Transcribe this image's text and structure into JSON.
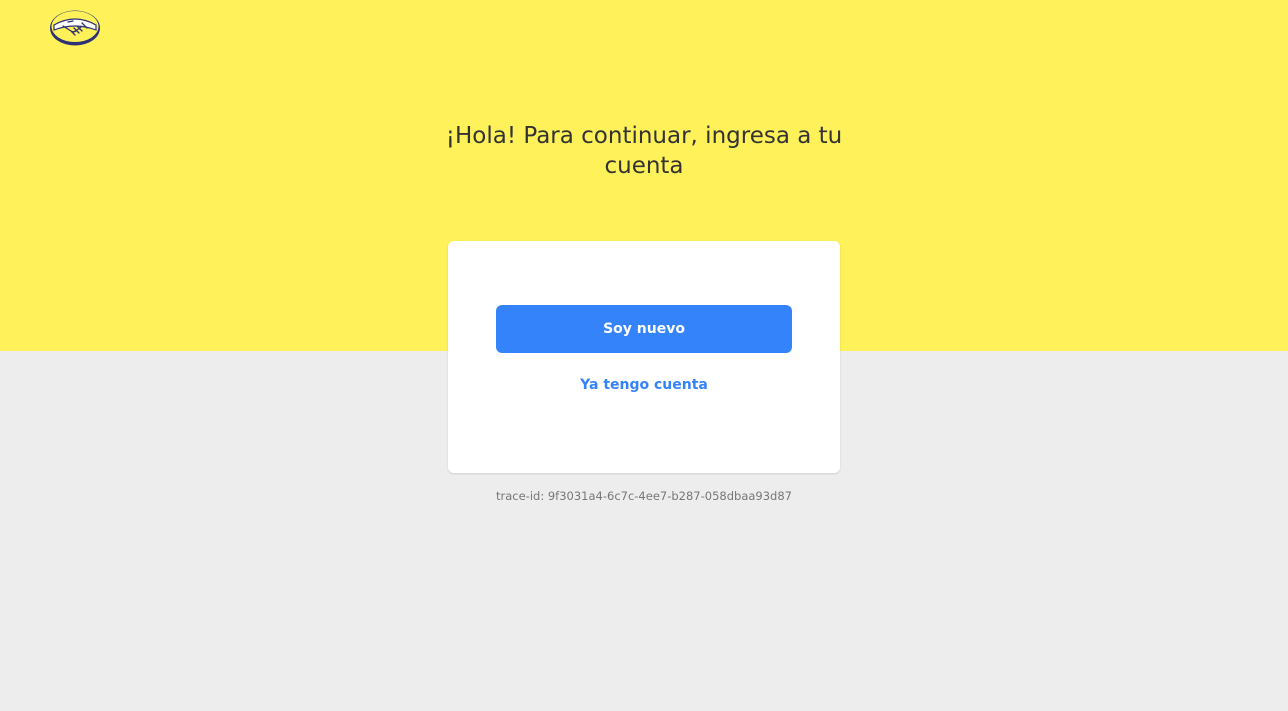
{
  "brand": {
    "logo_icon": "handshake-logo-icon",
    "background_color": "#fff159",
    "page_background_color": "#ededed",
    "accent_color": "#3483fa",
    "logo_color": "#2d3277"
  },
  "main": {
    "headline": "¡Hola! Para continuar, ingresa a tu cuenta"
  },
  "card": {
    "primary_button_label": "Soy nuevo",
    "secondary_button_label": "Ya tengo cuenta"
  },
  "footer": {
    "trace_id": "trace-id: 9f3031a4-6c7c-4ee7-b287-058dbaa93d87"
  }
}
